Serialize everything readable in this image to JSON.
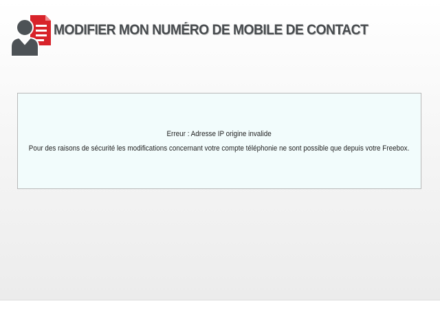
{
  "header": {
    "title": "MODIFIER MON NUMÉRO DE MOBILE DE CONTACT",
    "icon": "user-document-icon"
  },
  "message": {
    "error_line": "Erreur : Adresse IP origine invalide",
    "detail_line": "Pour des raisons de sécurité les modifications concernant votre compte téléphonie ne sont possible que depuis votre Freebox."
  },
  "colors": {
    "title": "#474b4e",
    "icon_person": "#4d5256",
    "icon_document": "#d8232a",
    "message_bg": "#f2fcfc",
    "message_border": "#b8b8b8"
  }
}
